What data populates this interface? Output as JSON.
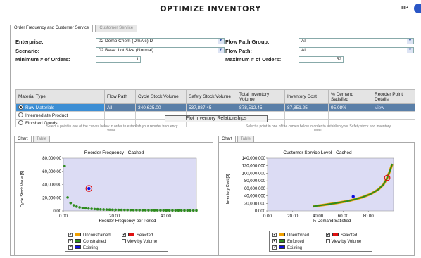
{
  "page": {
    "title": "OPTIMIZE INVENTORY",
    "tip": "TIP"
  },
  "tabs": {
    "active": "Order Frequency and Customer Service",
    "inactive": "Customer Service"
  },
  "form": {
    "enterprise_label": "Enterprise:",
    "enterprise_value": "02 Demo Chem (DmAlc) D",
    "scenario_label": "Scenario:",
    "scenario_value": "02 Base: Lot Size (Normal)",
    "min_orders_label": "Minimum # of Orders:",
    "min_orders_value": "1",
    "flow_path_group_label": "Flow Path Group:",
    "flow_path_group_value": "All",
    "flow_path_label": "Flow Path:",
    "flow_path_value": "All",
    "max_orders_label": "Maximum # of Orders:",
    "max_orders_value": "52"
  },
  "table": {
    "headers": [
      "Material Type",
      "Flow Path",
      "Cycle Stock Volume",
      "Safety Stock Volume",
      "Total Inventory Volume",
      "Inventory Cost",
      "% Demand Satisfied",
      "Reorder Point Details"
    ],
    "rows": [
      {
        "material": "Raw Materials",
        "flow": "All",
        "cycle": "340,625.00",
        "safety": "537,887.45",
        "total": "878,512.45",
        "cost": "87,851.25",
        "demand": "95.08%",
        "link": "View"
      },
      {
        "material": "Intermediate Product",
        "flow": "",
        "cycle": "",
        "safety": "",
        "total": "",
        "cost": "",
        "demand": "",
        "link": ""
      },
      {
        "material": "Finished Goods",
        "flow": "",
        "cycle": "",
        "safety": "",
        "total": "",
        "cost": "",
        "demand": "",
        "link": ""
      }
    ]
  },
  "plot_button": "Plot Inventory Relationships",
  "hints": {
    "left": "Select a point in one of the curves below in order to establish your reorder frequency value.",
    "right": "Select a point in one of the curves below in order to establish your Safety stock and inventory level."
  },
  "chart_tabs": {
    "chart": "Chart",
    "table": "Table"
  },
  "colors": {
    "selected_row": "#5a7fa8",
    "green": "#2e8b1e",
    "red": "#e01010",
    "blue": "#1010e0",
    "orange": "#f0a000",
    "plot_bg": "#dcdcf4"
  },
  "legend_left": {
    "unconstrained": "Unconstrained",
    "constrained": "Constrained",
    "existing": "Existing",
    "selected": "Selected",
    "by_volume": "View by Volume"
  },
  "legend_right": {
    "unenforced": "Unenforced",
    "enforced": "Enforced",
    "existing": "Existing",
    "selected": "Selected",
    "by_volume": "View by Volume"
  },
  "chart_data": [
    {
      "type": "scatter",
      "title": "Reorder Frequency - Cached",
      "xlabel": "Reorder Frequency per Period",
      "ylabel": "Cycle Stock Value [$]",
      "xlim": [
        0,
        52
      ],
      "ylim": [
        0,
        80000
      ],
      "xticks": [
        "0.00",
        "20.00",
        "40.00"
      ],
      "yticks": [
        "0.00",
        "20,000.00",
        "40,000.00",
        "60,000.00",
        "80,000.00"
      ],
      "series": [
        {
          "name": "Constrained",
          "k": 34062.5,
          "x_start": 0.5,
          "x_end": 52,
          "count": 45
        }
      ],
      "selected": {
        "x": 10,
        "y": 34062.5
      }
    },
    {
      "type": "line",
      "title": "Customer Service Level - Cached",
      "xlabel": "% Demand Satisfied",
      "ylabel": "Inventory Cost [$]",
      "xlim": [
        0,
        100
      ],
      "ylim": [
        0,
        140000000
      ],
      "xticks": [
        "0.00",
        "20.00",
        "40.00",
        "60.00",
        "80.00"
      ],
      "yticks": [
        "0.000",
        "20,000,000",
        "40,000,000",
        "60,000,000",
        "80,000,000",
        "100,000,000",
        "120,000,000",
        "140,000,000"
      ],
      "series": [
        {
          "name": "Unenforced",
          "points": [
            [
              36,
              12000000
            ],
            [
              45,
              16000000
            ],
            [
              55,
              21000000
            ],
            [
              65,
              27000000
            ],
            [
              75,
              36000000
            ],
            [
              82,
              45000000
            ],
            [
              88,
              57000000
            ],
            [
              92,
              70000000
            ],
            [
              95,
              87851250
            ],
            [
              97,
              105000000
            ],
            [
              99,
              125000000
            ]
          ]
        },
        {
          "name": "Enforced",
          "points": [
            [
              36,
              12000000
            ],
            [
              45,
              16000000
            ],
            [
              55,
              21000000
            ],
            [
              65,
              27000000
            ],
            [
              75,
              36000000
            ],
            [
              82,
              45000000
            ],
            [
              88,
              57000000
            ],
            [
              92,
              70000000
            ],
            [
              95,
              87851250
            ],
            [
              97,
              105000000
            ],
            [
              99,
              125000000
            ]
          ]
        }
      ],
      "existing": {
        "x": 68,
        "y": 38000000
      },
      "selected": {
        "x": 95,
        "y": 87851250
      }
    }
  ]
}
